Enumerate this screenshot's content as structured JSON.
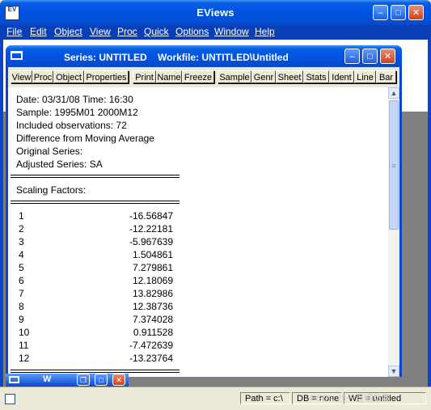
{
  "app": {
    "title": "EViews",
    "icon": "eviews-app-icon",
    "menu": [
      "File",
      "Edit",
      "Object",
      "View",
      "Proc",
      "Quick",
      "Options",
      "Window",
      "Help"
    ]
  },
  "child": {
    "title": "Series: UNTITLED    Workfile: UNTITLED\\Untitled",
    "toolbar": [
      "View",
      "Proc",
      "Object",
      "Properties",
      "Print",
      "Name",
      "Freeze",
      "Sample",
      "Genr",
      "Sheet",
      "Stats",
      "Ident",
      "Line",
      "Bar"
    ],
    "output": {
      "header": [
        "Date: 03/31/08   Time: 16:30",
        "Sample: 1995M01 2000M12",
        "Included observations: 72",
        "Difference from Moving Average",
        "Original Series:",
        "Adjusted Series: SA"
      ],
      "scaling_label": "Scaling Factors:",
      "rows": [
        {
          "n": "1",
          "v": "-16.56847"
        },
        {
          "n": "2",
          "v": "-12.22181"
        },
        {
          "n": "3",
          "v": "-5.967639"
        },
        {
          "n": "4",
          "v": "1.504861"
        },
        {
          "n": "5",
          "v": "7.279861"
        },
        {
          "n": "6",
          "v": "12.18069"
        },
        {
          "n": "7",
          "v": "13.82986"
        },
        {
          "n": "8",
          "v": "12.38736"
        },
        {
          "n": "9",
          "v": "7.374028"
        },
        {
          "n": "10",
          "v": "0.911528"
        },
        {
          "n": "11",
          "v": "-7.472639"
        },
        {
          "n": "12",
          "v": "-13.23764"
        }
      ]
    }
  },
  "minimized": {
    "label": "W"
  },
  "status": {
    "path": "Path = c:\\",
    "db": "DB = none",
    "wf": "WF = untitled",
    "watermark": "CSDN @一直细数数"
  },
  "colors": {
    "titlebar": "#0054e3",
    "desktop": "#808080",
    "face": "#ece9d8"
  }
}
